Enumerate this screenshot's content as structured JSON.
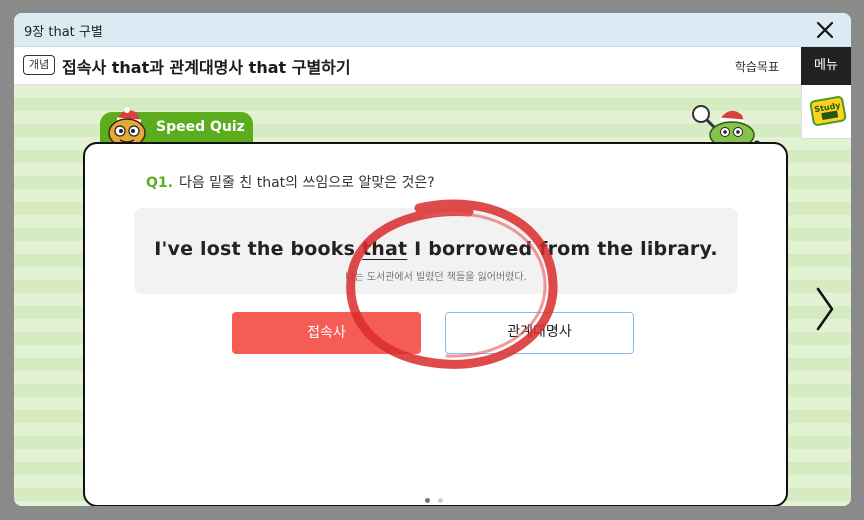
{
  "window": {
    "title": "9장 that 구별",
    "close_icon": "close-icon"
  },
  "header": {
    "badge": "개념",
    "lesson_title": "접속사 that과 관계대명사 that 구별하기",
    "goal_link": "학습목표",
    "menu_label": "메뉴"
  },
  "side": {
    "study_logo_text": "Study 영어"
  },
  "quiz": {
    "tab_label": "Speed Quiz",
    "question_number": "Q1.",
    "question_text": "다음 밑줄 친 that의 쓰임으로 알맞은 것은?",
    "sentence_before": "I've lost the books ",
    "sentence_underlined": "that",
    "sentence_after": " I borrowed from the library.",
    "translation": "나는 도서관에서 빌렸던 책들을 잃어버렸다.",
    "answers": [
      {
        "label": "접속사",
        "selected": true
      },
      {
        "label": "관계대명사",
        "selected": false
      }
    ],
    "correct_mark": "red-circle",
    "pagination": {
      "current": 1,
      "total": 2
    }
  },
  "colors": {
    "accent_green": "#5cad1d",
    "selected_answer": "#f45c55",
    "answer_border": "#8fb8e8",
    "titlebar": "#dcebf3"
  }
}
